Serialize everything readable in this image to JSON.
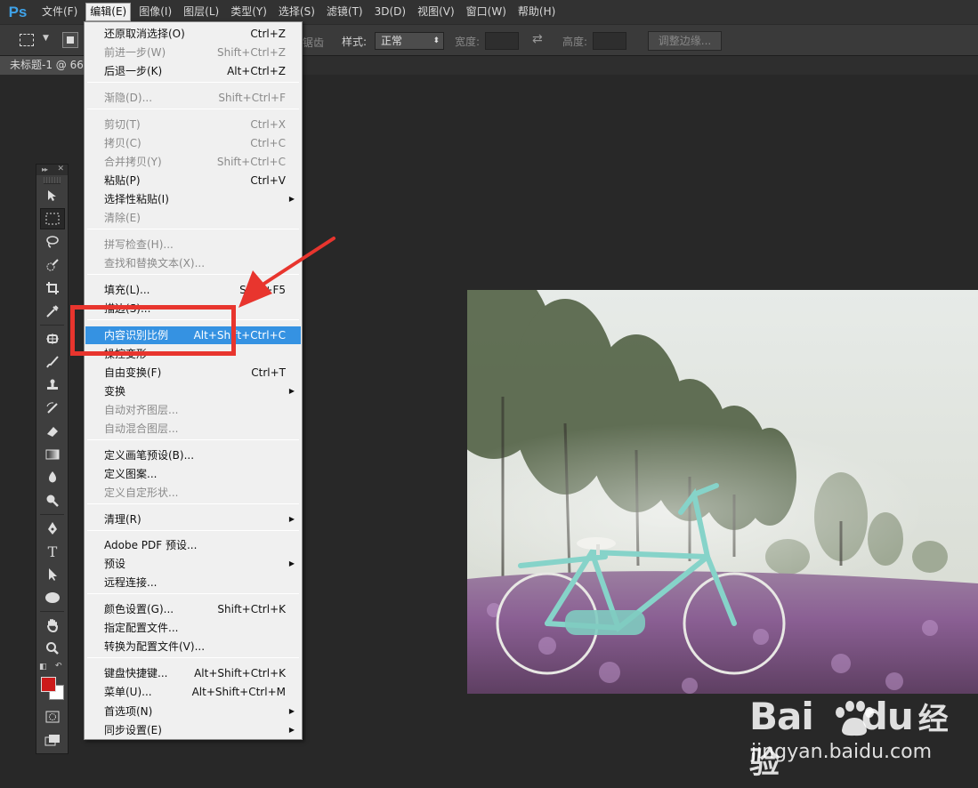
{
  "app": {
    "logo": "Ps"
  },
  "menubar": {
    "items": [
      {
        "label": "文件(F)",
        "active": false
      },
      {
        "label": "编辑(E)",
        "active": true
      },
      {
        "label": "图像(I)",
        "active": false
      },
      {
        "label": "图层(L)",
        "active": false
      },
      {
        "label": "类型(Y)",
        "active": false
      },
      {
        "label": "选择(S)",
        "active": false
      },
      {
        "label": "滤镜(T)",
        "active": false
      },
      {
        "label": "3D(D)",
        "active": false
      },
      {
        "label": "视图(V)",
        "active": false
      },
      {
        "label": "窗口(W)",
        "active": false
      },
      {
        "label": "帮助(H)",
        "active": false
      }
    ]
  },
  "options": {
    "feather_partial": "锯齿",
    "style_label": "样式:",
    "style_value": "正常",
    "width_label": "宽度:",
    "height_label": "高度:",
    "refine_edge": "调整边缘..."
  },
  "document": {
    "tab_title": "未标题-1 @ 66."
  },
  "toolbox": {
    "tools": [
      "move-icon",
      "marquee-icon",
      "lasso-icon",
      "quick-select-icon",
      "crop-icon",
      "eyedropper-icon",
      "spot-heal-icon",
      "brush-icon",
      "stamp-icon",
      "history-brush-icon",
      "eraser-icon",
      "gradient-icon",
      "blur-icon",
      "dodge-icon",
      "pen-icon",
      "type-icon",
      "path-select-icon",
      "ellipse-icon",
      "hand-icon",
      "zoom-icon"
    ],
    "type_glyph": "T",
    "foreground": "#cc1a1a",
    "background": "#ffffff"
  },
  "edit_menu": {
    "items": [
      {
        "label": "还原取消选择(O)",
        "shortcut": "Ctrl+Z",
        "disabled": false
      },
      {
        "label": "前进一步(W)",
        "shortcut": "Shift+Ctrl+Z",
        "disabled": true
      },
      {
        "label": "后退一步(K)",
        "shortcut": "Alt+Ctrl+Z",
        "disabled": false
      },
      {
        "label": "渐隐(D)...",
        "shortcut": "Shift+Ctrl+F",
        "disabled": true
      },
      {
        "label": "剪切(T)",
        "shortcut": "Ctrl+X",
        "disabled": true
      },
      {
        "label": "拷贝(C)",
        "shortcut": "Ctrl+C",
        "disabled": true
      },
      {
        "label": "合并拷贝(Y)",
        "shortcut": "Shift+Ctrl+C",
        "disabled": true
      },
      {
        "label": "粘贴(P)",
        "shortcut": "Ctrl+V",
        "disabled": false
      },
      {
        "label": "选择性粘贴(I)",
        "shortcut": "",
        "disabled": false,
        "submenu": true
      },
      {
        "label": "清除(E)",
        "shortcut": "",
        "disabled": true
      },
      {
        "label": "拼写检查(H)...",
        "shortcut": "",
        "disabled": true
      },
      {
        "label": "查找和替换文本(X)...",
        "shortcut": "",
        "disabled": true
      },
      {
        "label": "填充(L)...",
        "shortcut": "Shift+F5",
        "disabled": false
      },
      {
        "label": "描边(S)...",
        "shortcut": "",
        "disabled": false
      },
      {
        "label": "内容识别比例",
        "shortcut": "Alt+Shift+Ctrl+C",
        "disabled": false,
        "highlight": true
      },
      {
        "label": "操控变形",
        "shortcut": "",
        "disabled": false
      },
      {
        "label": "自由变换(F)",
        "shortcut": "Ctrl+T",
        "disabled": false
      },
      {
        "label": "变换",
        "shortcut": "",
        "disabled": false,
        "submenu": true
      },
      {
        "label": "自动对齐图层...",
        "shortcut": "",
        "disabled": true
      },
      {
        "label": "自动混合图层...",
        "shortcut": "",
        "disabled": true
      },
      {
        "label": "定义画笔预设(B)...",
        "shortcut": "",
        "disabled": false
      },
      {
        "label": "定义图案...",
        "shortcut": "",
        "disabled": false
      },
      {
        "label": "定义自定形状...",
        "shortcut": "",
        "disabled": true
      },
      {
        "label": "清理(R)",
        "shortcut": "",
        "disabled": false,
        "submenu": true
      },
      {
        "label": "Adobe PDF 预设...",
        "shortcut": "",
        "disabled": false
      },
      {
        "label": "预设",
        "shortcut": "",
        "disabled": false,
        "submenu": true
      },
      {
        "label": "远程连接...",
        "shortcut": "",
        "disabled": false
      },
      {
        "label": "颜色设置(G)...",
        "shortcut": "Shift+Ctrl+K",
        "disabled": false
      },
      {
        "label": "指定配置文件...",
        "shortcut": "",
        "disabled": false
      },
      {
        "label": "转换为配置文件(V)...",
        "shortcut": "",
        "disabled": false
      },
      {
        "label": "键盘快捷键...",
        "shortcut": "Alt+Shift+Ctrl+K",
        "disabled": false
      },
      {
        "label": "菜单(U)...",
        "shortcut": "Alt+Shift+Ctrl+M",
        "disabled": false
      },
      {
        "label": "首选项(N)",
        "shortcut": "",
        "disabled": false,
        "submenu": true
      },
      {
        "label": "同步设置(E)",
        "shortcut": "",
        "disabled": false,
        "submenu": true
      }
    ]
  },
  "watermark": {
    "brand_latin": "Bai",
    "brand_du": "du",
    "brand_cn": "经验",
    "url": "jingyan.baidu.com"
  },
  "colors": {
    "highlight": "#3592e2",
    "annotation_red": "#e8352e",
    "ps_blue": "#3fa2e8"
  }
}
